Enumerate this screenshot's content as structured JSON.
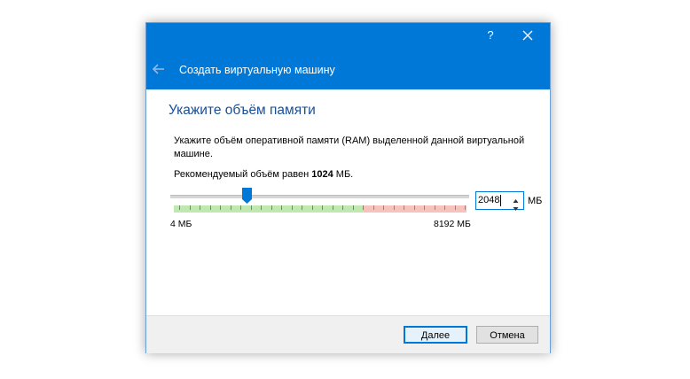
{
  "window": {
    "help_label": "?",
    "wizard_title": "Создать виртуальную машину",
    "accent_color": "#0078d7"
  },
  "page": {
    "heading": "Укажите объём памяти",
    "description": "Укажите объём оперативной памяти (RAM) выделенной данной виртуальной машине.",
    "recommend_prefix": "Рекомендуемый объём равен ",
    "recommend_value": "1024",
    "recommend_suffix": " МБ."
  },
  "memory": {
    "value": "2048",
    "unit": "МБ",
    "min_label": "4 МБ",
    "max_label": "8192 МБ",
    "slider_fraction": 0.25
  },
  "buttons": {
    "next": "Далее",
    "cancel": "Отмена"
  },
  "icons": [
    "back-arrow-icon",
    "close-icon",
    "spin-up-icon",
    "spin-down-icon"
  ]
}
